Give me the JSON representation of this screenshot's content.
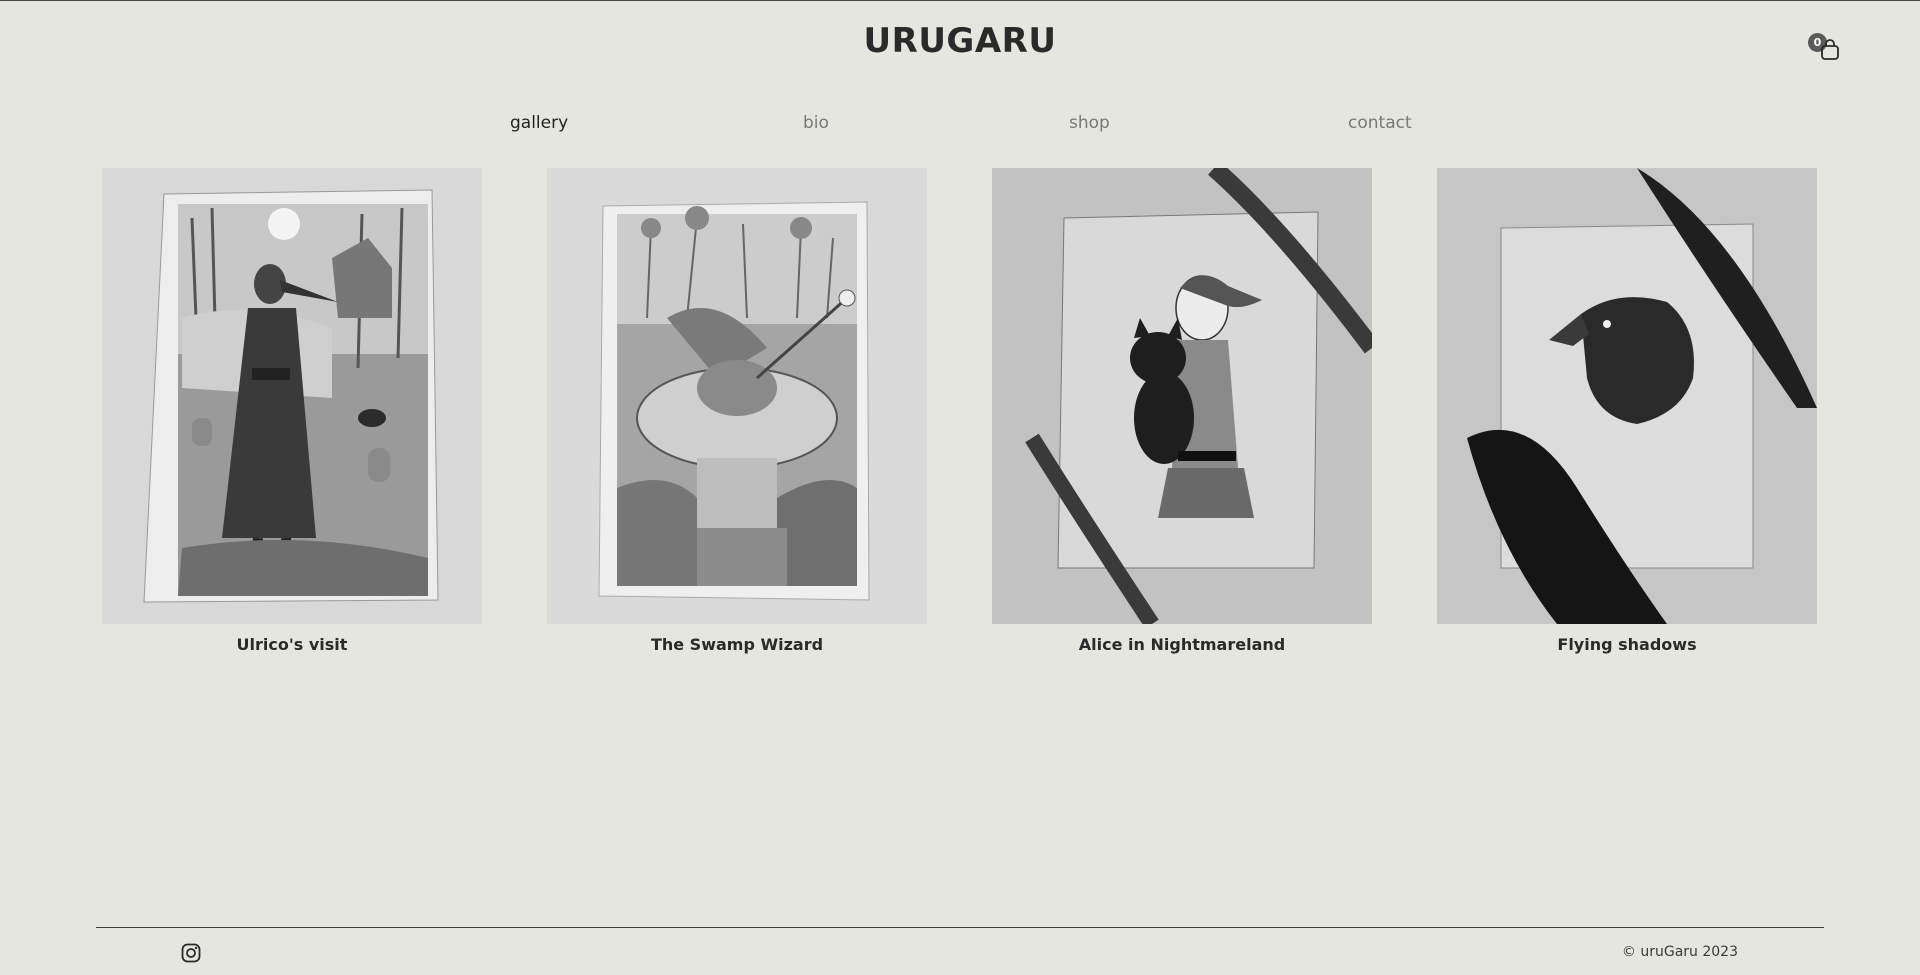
{
  "header": {
    "site_title": "URUGARU",
    "cart_count": "0"
  },
  "nav": {
    "items": [
      {
        "label": "gallery"
      },
      {
        "label": "bio"
      },
      {
        "label": "shop"
      },
      {
        "label": "contact"
      }
    ],
    "active": "gallery"
  },
  "gallery": {
    "items": [
      {
        "title": "Ulrico's visit"
      },
      {
        "title": "The Swamp Wizard"
      },
      {
        "title": "Alice in Nightmareland"
      },
      {
        "title": "Flying shadows"
      }
    ]
  },
  "footer": {
    "social_icon": "instagram-icon",
    "copyright": "© uruGaru 2023"
  }
}
